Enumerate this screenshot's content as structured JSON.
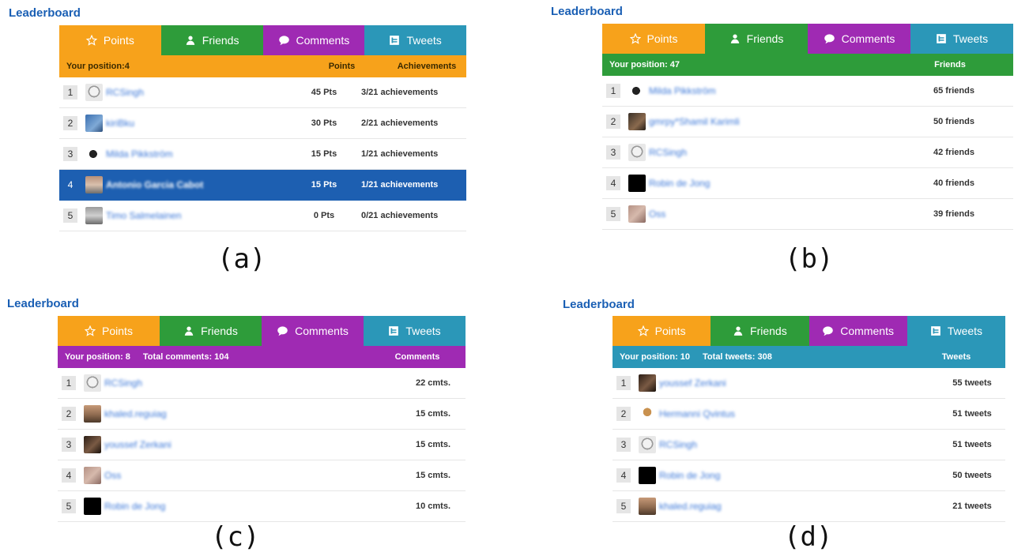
{
  "title": "Leaderboard",
  "tabs": {
    "points": "Points",
    "friends": "Friends",
    "comments": "Comments",
    "tweets": "Tweets"
  },
  "icons": {
    "points": "star-icon",
    "friends": "person-icon",
    "comments": "speech-bubble-icon",
    "tweets": "tweet-box-icon"
  },
  "colors": {
    "points": "#f7a21b",
    "friends": "#2e9c3a",
    "comments": "#9f2ab3",
    "tweets": "#2b97b8",
    "highlight": "#1d5fb1",
    "title": "#1a5fb4"
  },
  "panels": [
    {
      "caption": "(a)",
      "active_tab": "points",
      "position_label": "Your position:4",
      "col1": "Points",
      "col2": "Achievements",
      "rows": [
        {
          "rank": "1",
          "name": "RCSingh",
          "value": "45 Pts",
          "extra": "3/21 achievements"
        },
        {
          "rank": "2",
          "name": "kiriBku",
          "value": "30 Pts",
          "extra": "2/21 achievements"
        },
        {
          "rank": "3",
          "name": "Milda Pikkström",
          "value": "15 Pts",
          "extra": "1/21 achievements"
        },
        {
          "rank": "4",
          "name": "Antonio Garcia Cabot",
          "value": "15 Pts",
          "extra": "1/21 achievements"
        },
        {
          "rank": "5",
          "name": "Timo Salmelainen",
          "value": "0 Pts",
          "extra": "0/21 achievements"
        }
      ]
    },
    {
      "caption": "(b)",
      "active_tab": "friends",
      "position_label": "Your position: 47",
      "col1": "Friends",
      "rows": [
        {
          "rank": "1",
          "name": "Milda Pikkström",
          "value": "65 friends"
        },
        {
          "rank": "2",
          "name": "gmrpy*Shamil Karimli",
          "value": "50 friends"
        },
        {
          "rank": "3",
          "name": "RCSingh",
          "value": "42 friends"
        },
        {
          "rank": "4",
          "name": "Robin de Jong",
          "value": "40 friends"
        },
        {
          "rank": "5",
          "name": "Oss",
          "value": "39 friends"
        }
      ]
    },
    {
      "caption": "(c)",
      "active_tab": "comments",
      "position_label": "Your position: 8",
      "total_label": "Total comments: 104",
      "col1": "Comments",
      "rows": [
        {
          "rank": "1",
          "name": "RCSingh",
          "value": "22 cmts."
        },
        {
          "rank": "2",
          "name": "khaled.reguiag",
          "value": "15 cmts."
        },
        {
          "rank": "3",
          "name": "youssef Zerkani",
          "value": "15 cmts."
        },
        {
          "rank": "4",
          "name": "Oss",
          "value": "15 cmts."
        },
        {
          "rank": "5",
          "name": "Robin de Jong",
          "value": "10 cmts."
        }
      ]
    },
    {
      "caption": "(d)",
      "active_tab": "tweets",
      "position_label": "Your position: 10",
      "total_label": "Total tweets: 308",
      "col1": "Tweets",
      "rows": [
        {
          "rank": "1",
          "name": "youssef Zerkani",
          "value": "55 tweets"
        },
        {
          "rank": "2",
          "name": "Hermanni Qvintus",
          "value": "51 tweets"
        },
        {
          "rank": "3",
          "name": "RCSingh",
          "value": "51 tweets"
        },
        {
          "rank": "4",
          "name": "Robin de Jong",
          "value": "50 tweets"
        },
        {
          "rank": "5",
          "name": "khaled.reguiag",
          "value": "21 tweets"
        }
      ]
    }
  ]
}
